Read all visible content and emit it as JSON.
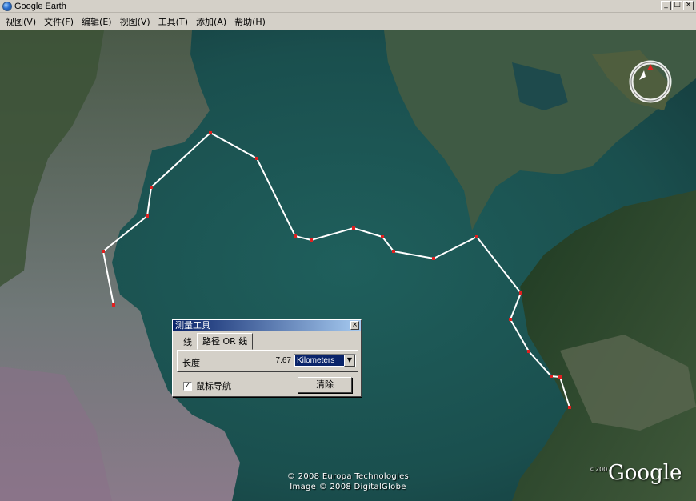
{
  "window": {
    "title": "Google Earth",
    "controls": {
      "minimize": "_",
      "maximize": "□",
      "close": "×"
    }
  },
  "menu": [
    {
      "label": "视图(V)"
    },
    {
      "label": "文件(F)"
    },
    {
      "label": "编辑(E)"
    },
    {
      "label": "视图(V)"
    },
    {
      "label": "工具(T)"
    },
    {
      "label": "添加(A)"
    },
    {
      "label": "帮助(H)"
    }
  ],
  "map": {
    "attribution_line1": "© 2008 Europa Technologies",
    "attribution_line2": "Image © 2008 DigitalGlobe",
    "copyright_year": "©2007",
    "logo": "Google",
    "path_color": "#ffffff",
    "vertex_color": "#e02020"
  },
  "ruler_dialog": {
    "title": "测量工具",
    "close_glyph": "×",
    "tabs": [
      {
        "label": "线"
      },
      {
        "label": "路径 OR 线"
      }
    ],
    "length_label": "长度",
    "length_value": "7.67",
    "unit_selected": "Kilometers",
    "dropdown_glyph": "▼",
    "mouse_nav_label": "鼠标导航",
    "mouse_nav_checked": "✓",
    "clear_label": "清除"
  }
}
